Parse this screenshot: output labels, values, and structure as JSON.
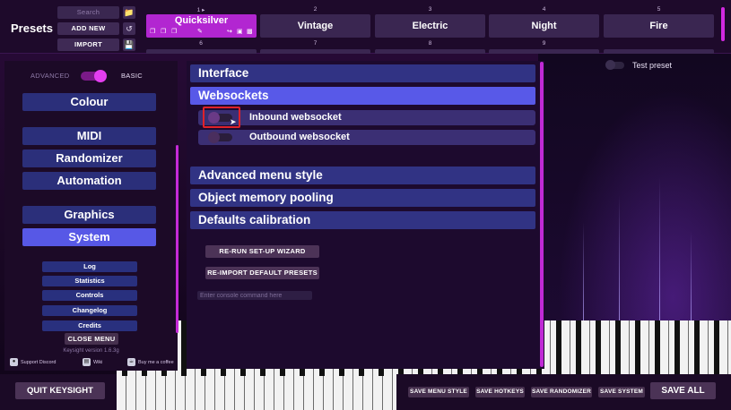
{
  "presets": {
    "title": "Presets",
    "search_placeholder": "Search",
    "add_new_label": "ADD NEW",
    "import_label": "IMPORT",
    "slots": [
      {
        "number": "1",
        "name": "Quicksilver",
        "active": true
      },
      {
        "number": "2",
        "name": "Vintage"
      },
      {
        "number": "3",
        "name": "Electric"
      },
      {
        "number": "4",
        "name": "Night"
      },
      {
        "number": "5",
        "name": "Fire"
      }
    ],
    "row2_numbers": [
      "6",
      "7",
      "8",
      "9"
    ]
  },
  "sidebar": {
    "advanced_label": "ADVANCED",
    "basic_label": "BASIC",
    "items": [
      {
        "label": "Colour"
      },
      {
        "label": "MIDI"
      },
      {
        "label": "Randomizer"
      },
      {
        "label": "Automation"
      },
      {
        "label": "Graphics"
      },
      {
        "label": "System",
        "selected": true
      }
    ],
    "sub_items": [
      {
        "label": "Log"
      },
      {
        "label": "Statistics"
      },
      {
        "label": "Controls"
      },
      {
        "label": "Changelog"
      },
      {
        "label": "Credits"
      }
    ],
    "close_menu_label": "CLOSE MENU",
    "version": "Keysight version 1.6.3g",
    "links": {
      "discord": "Support Discord",
      "wiki": "Wiki",
      "coffee": "Buy me a coffee"
    }
  },
  "main": {
    "sections": {
      "interface": "Interface",
      "websockets": "Websockets",
      "advanced_menu_style": "Advanced menu style",
      "object_memory_pooling": "Object memory pooling",
      "defaults_calibration": "Defaults calibration"
    },
    "websocket_settings": {
      "inbound": {
        "label": "Inbound websocket",
        "enabled": false
      },
      "outbound": {
        "label": "Outbound websocket",
        "enabled": false
      }
    },
    "rerun_wizard_label": "RE-RUN SET-UP WIZARD",
    "reimport_label": "RE-IMPORT DEFAULT PRESETS",
    "console_placeholder": "Enter console command here"
  },
  "test_preset": {
    "label": "Test preset",
    "enabled": false
  },
  "footer": {
    "quit_label": "QUIT KEYSIGHT",
    "save_menu_style": "SAVE MENU STYLE",
    "save_hotkeys": "SAVE HOTKEYS",
    "save_randomizer": "SAVE RANDOMIZER",
    "save_system": "SAVE SYSTEM",
    "save_all": "SAVE ALL"
  },
  "colors": {
    "accent": "#b226d1",
    "section": "#313384",
    "section_open": "#5859e8",
    "highlight_box": "#e0222a"
  }
}
